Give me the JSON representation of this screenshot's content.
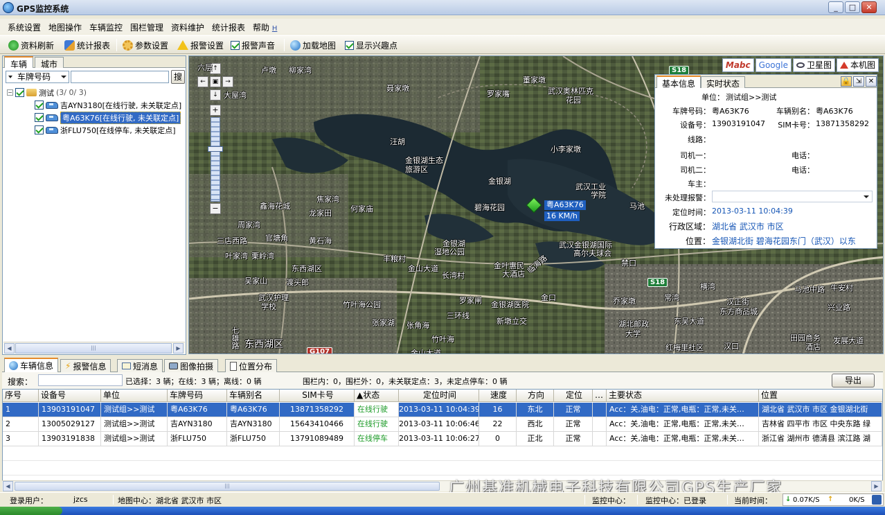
{
  "window": {
    "title": "GPS监控系统"
  },
  "menu": [
    "系统设置",
    "地图操作",
    "车辆监控",
    "围栏管理",
    "资料维护",
    "统计报表",
    "帮助"
  ],
  "menu_help_shortcut": "H",
  "toolbar": {
    "refresh": "资料刷新",
    "stats": "统计报表",
    "params": "参数设置",
    "alarm_settings": "报警设置",
    "alarm_sound": "报警声音",
    "load_map": "加载地图",
    "show_poi": "显示兴趣点"
  },
  "left": {
    "tabs": [
      "车辆",
      "城市"
    ],
    "select_value": "车牌号码",
    "search_button": "搜",
    "group": {
      "name": "测试",
      "counts": "(3/ 0/ 3)"
    },
    "vehicles": [
      {
        "plate": "吉AYN3180",
        "status": "[在线行驶, 未关联定点]"
      },
      {
        "plate": "粤A63K76",
        "status": "[在线行驶, 未关联定点]"
      },
      {
        "plate": "浙FLU750",
        "status": "[在线停车, 未关联定点]"
      }
    ]
  },
  "map": {
    "types": {
      "mabc": "Mabc",
      "google": "Google",
      "satellite": "卫星图",
      "local": "本机图"
    },
    "shields": [
      "S18",
      "S18",
      "G107"
    ],
    "labels": [
      "六层",
      "卢墩",
      "柳家湾",
      "大屋湾",
      "聂家墩",
      "董家墩",
      "罗家嘴",
      "武汉奥林匹克",
      "花园",
      "汪胡",
      "金银湖生态",
      "旅游区",
      "小李家墩",
      "金银湖",
      "武汉工业",
      "学院",
      "鑫海花城",
      "龙家田",
      "何家庙",
      "焦家湾",
      "碧海花园",
      "马池",
      "周家湾",
      "三店西路",
      "官塘角",
      "黄石海",
      "叶家湾",
      "栗岭湾",
      "东西湖区",
      "丰粮村",
      "金银湖",
      "湿地公园",
      "金叶惠民",
      "大酒店",
      "武汉金银湖国际",
      "高尔夫球会",
      "禁口",
      "吴家山",
      "渡头郎",
      "金山大道",
      "长湾村",
      "武汉护理",
      "学校",
      "竹叶海公园",
      "罗家闸",
      "金银湖医院",
      "金口",
      "乔家墩",
      "常湾",
      "横湾",
      "汉正街",
      "东方商品城",
      "马池中路",
      "牛安村",
      "兴业路",
      "东吴大道",
      "张家湖",
      "张角海",
      "三环线",
      "新墩立交",
      "湖北邮政",
      "大学",
      "汉口",
      "红梅里社区",
      "田园商务",
      "酒店",
      "发展大道",
      "东西湖区",
      "竹叶海",
      "金山大道",
      "七雄路",
      "临海路"
    ],
    "vehicle_marker": {
      "plate": "粤A63K76",
      "speed": "16 KM/h"
    }
  },
  "info": {
    "tabs": [
      "基本信息",
      "实时状态"
    ],
    "unit_label": "单位：",
    "unit": "测试组>>测试",
    "plate_label": "车牌号码：",
    "plate": "粤A63K76",
    "alias_label": "车辆别名：",
    "alias": "粤A63K76",
    "device_label": "设备号：",
    "device": "13903191047",
    "sim_label": "SIM卡号：",
    "sim": "13871358292",
    "route_label": "线路：",
    "driver1_label": "司机一：",
    "phone1_label": "电话：",
    "driver2_label": "司机二：",
    "phone2_label": "电话：",
    "owner_label": "车主：",
    "alarm_label": "未处理报警：",
    "time_label": "定位时间：",
    "time": "2013-03-11 10:04:39",
    "region_label": "行政区域：",
    "region": "湖北省 武汉市 市区",
    "position_label": "位置：",
    "position": "金银湖北街 碧海花园东门（武汉）以东"
  },
  "bottom": {
    "tabs": [
      "车辆信息",
      "报警信息",
      "短消息",
      "图像拍摄",
      "位置分布"
    ],
    "search_label": "搜索：",
    "summary1": "已选择：3 辆；在线：3 辆；离线：0 辆",
    "summary2": "围栏内：0，围栏外：0，未关联定点：3，未定点停车：0 辆",
    "export": "导出",
    "columns": [
      "序号",
      "设备号",
      "单位",
      "车牌号码",
      "车辆别名",
      "SIM卡号",
      "▲状态",
      "定位时间",
      "速度",
      "方向",
      "定位",
      "…",
      "主要状态",
      "位置"
    ],
    "rows": [
      {
        "no": "1",
        "device": "13903191047",
        "unit": "测试组>>测试",
        "plate": "粤A63K76",
        "alias": "粤A63K76",
        "sim": "13871358292",
        "status": "在线行驶",
        "time": "2013-03-11 10:04:39",
        "speed": "16",
        "dir": "东北",
        "fix": "正常",
        "main": "Acc：关,油电：正常,电瓶：正常,未关…",
        "pos": "湖北省 武汉市 市区 金银湖北街"
      },
      {
        "no": "2",
        "device": "13005029127",
        "unit": "测试组>>测试",
        "plate": "吉AYN3180",
        "alias": "吉AYN3180",
        "sim": "15643410466",
        "status": "在线行驶",
        "time": "2013-03-11 10:06:46",
        "speed": "22",
        "dir": "西北",
        "fix": "正常",
        "main": "Acc：关,油电：正常,电瓶：正常,未关…",
        "pos": "吉林省 四平市 市区 中央东路 绿"
      },
      {
        "no": "3",
        "device": "13903191838",
        "unit": "测试组>>测试",
        "plate": "浙FLU750",
        "alias": "浙FLU750",
        "sim": "13791089489",
        "status": "在线停车",
        "time": "2013-03-11 10:06:27",
        "speed": "0",
        "dir": "正北",
        "fix": "正常",
        "main": "Acc：关,油电：正常,电瓶：正常,未关…",
        "pos": "浙江省 湖州市 德清县 滨江路 湖"
      }
    ],
    "watermark": "广州基准机械电子科技有限公司GPS生产厂家"
  },
  "status": {
    "login_label": "登录用户：",
    "login_user": "jzcs",
    "map_center": "地图中心：湖北省 武汉市 市区",
    "monitor_center": "监控中心：",
    "monitor_center2": "监控中心：已登录",
    "current_time": "当前时间：",
    "down_rate": "0.07K/S",
    "up_rate": "0K/S"
  },
  "colors": {
    "selection": "#316ac5",
    "status_green": "#1d9b28",
    "link_blue": "#1555b5",
    "tab_accent": "#e68b2c"
  }
}
